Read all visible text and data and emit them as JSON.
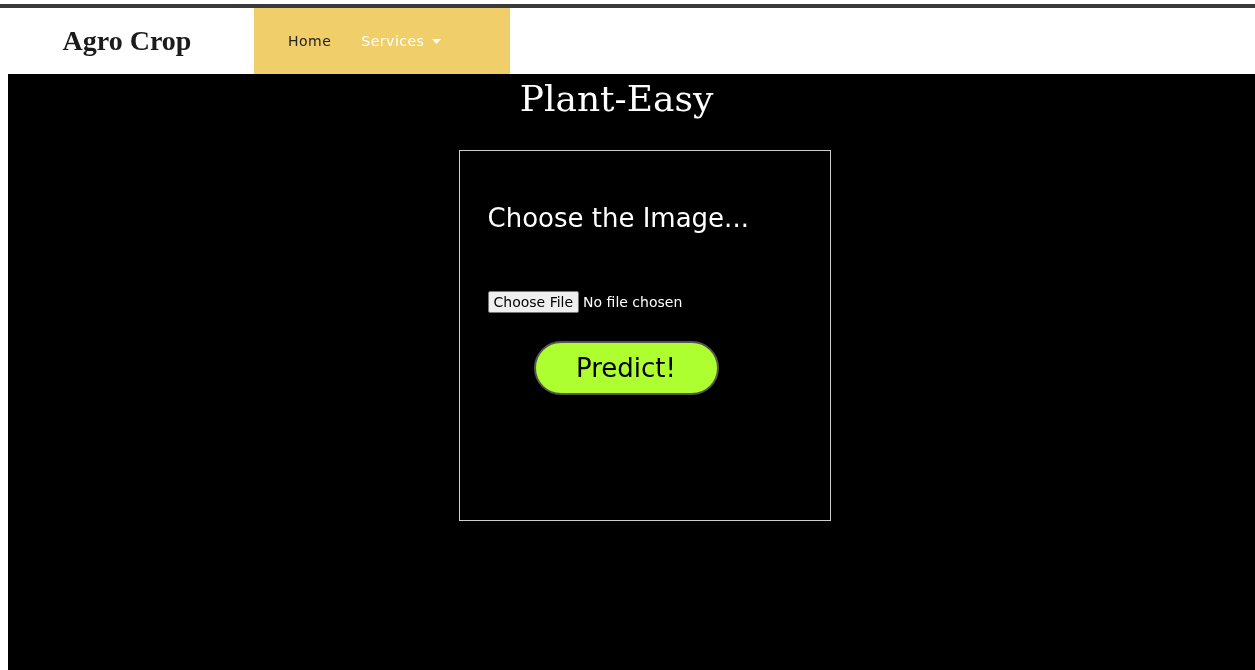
{
  "brand": "Agro Crop",
  "nav": [
    {
      "label": "Home",
      "selected": true,
      "dropdown": false
    },
    {
      "label": "Services",
      "selected": false,
      "dropdown": true
    }
  ],
  "title": "Plant-Easy",
  "form": {
    "heading": "Choose the Image...",
    "file_button": "Choose File",
    "file_status": "No file chosen",
    "submit": "Predict!"
  }
}
